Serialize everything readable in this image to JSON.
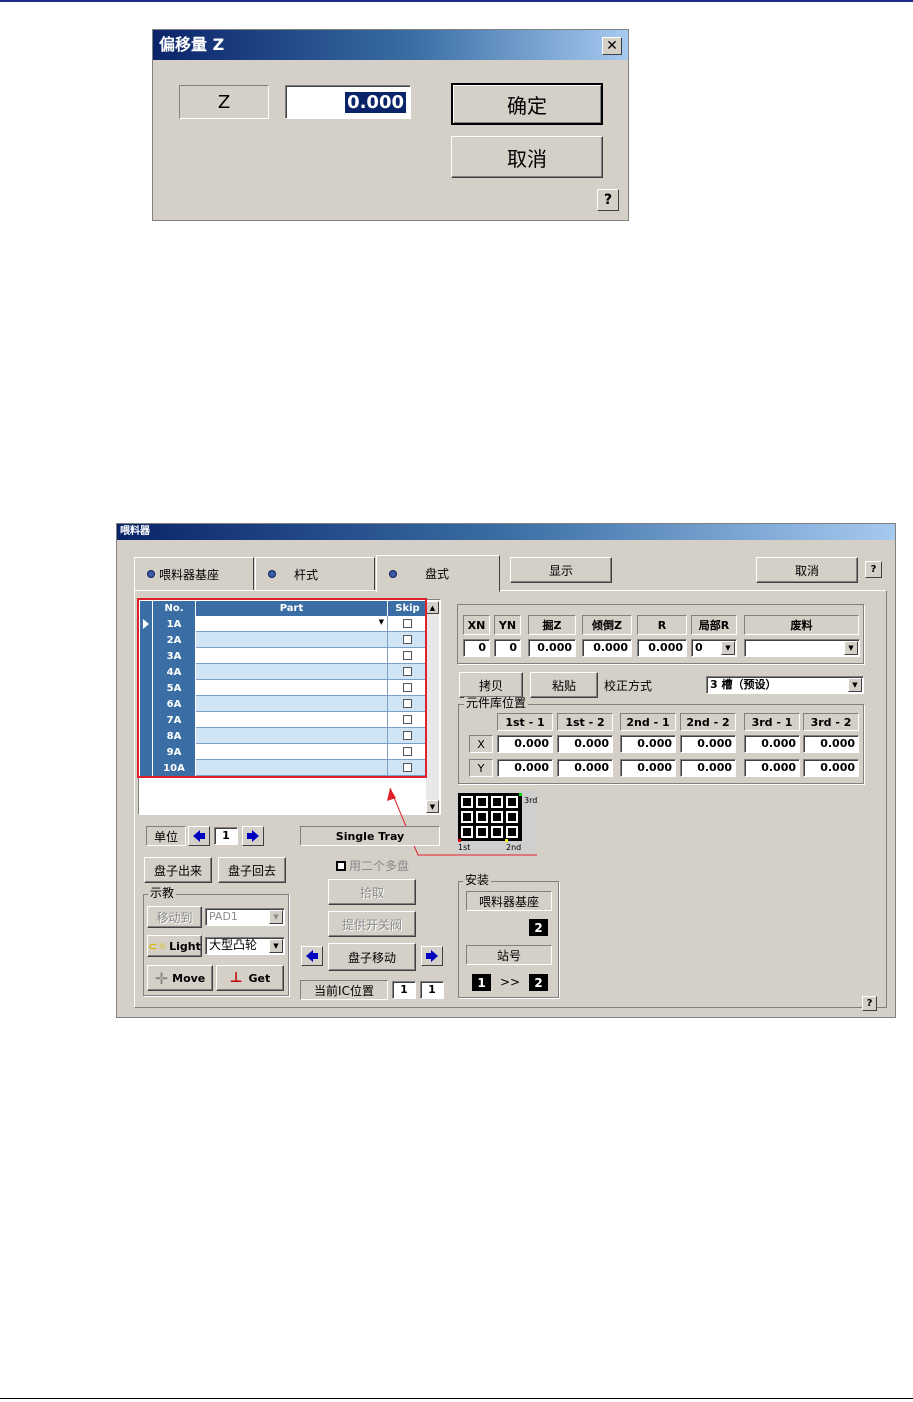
{
  "offset_dialog": {
    "title": "偏移量 Z",
    "close_glyph": "✕",
    "z_label": "Z",
    "z_value": "0.000",
    "ok_label": "确定",
    "cancel_label": "取消",
    "help_glyph": "?"
  },
  "feeder_dialog": {
    "title": "喂料器",
    "tabs": [
      {
        "label": "喂料器基座"
      },
      {
        "label": "杆式"
      },
      {
        "label": "盘式"
      }
    ],
    "display_button": "显示",
    "cancel_button": "取消",
    "help_glyph": "?",
    "grid": {
      "headers": [
        "No.",
        "Part",
        "Skip"
      ],
      "rows": [
        "1A",
        "2A",
        "3A",
        "4A",
        "5A",
        "6A",
        "7A",
        "8A",
        "9A",
        "10A"
      ]
    },
    "params": {
      "headers": [
        "XN",
        "YN",
        "掘Z",
        "倾倒Z",
        "R",
        "局部R",
        "废料"
      ],
      "values": [
        "0",
        "0",
        "0.000",
        "0.000",
        "0.000",
        "0",
        ""
      ]
    },
    "copy_button": "拷贝",
    "paste_button": "粘贴",
    "calib_label": "校正方式",
    "calib_value": "3 槽（预设）",
    "library": {
      "title": "元件库位置",
      "headers": [
        "1st - 1",
        "1st - 2",
        "2nd - 1",
        "2nd - 2",
        "3rd - 1",
        "3rd - 2"
      ],
      "x_label": "X",
      "y_label": "Y",
      "x_values": [
        "0.000",
        "0.000",
        "0.000",
        "0.000",
        "0.000",
        "0.000"
      ],
      "y_values": [
        "0.000",
        "0.000",
        "0.000",
        "0.000",
        "0.000",
        "0.000"
      ]
    },
    "tray_labels": {
      "first": "1st",
      "second": "2nd",
      "third": "3rd"
    },
    "unit_label": "单位",
    "unit_value": "1",
    "single_tray": "Single Tray",
    "use_two_label": "用二个多盘",
    "tray_out_button": "盘子出来",
    "tray_back_button": "盘子回去",
    "teach": {
      "title": "示教",
      "move_to_button": "移动到",
      "move_to_value": "PAD1",
      "light_button": "Light",
      "light_value": "大型凸轮",
      "move_button": "Move",
      "get_button": "Get"
    },
    "pick_button": "拾取",
    "valve_button": "提供开关阀",
    "tray_move_button": "盘子移动",
    "current_ic_label": "当前IC位置",
    "current_ic_x": "1",
    "current_ic_y": "1",
    "install": {
      "title": "安装",
      "base_label": "喂料器基座",
      "base_value": "2",
      "station_label": "站号",
      "station_from": "1",
      "station_arrow": ">>",
      "station_to": "2"
    }
  }
}
